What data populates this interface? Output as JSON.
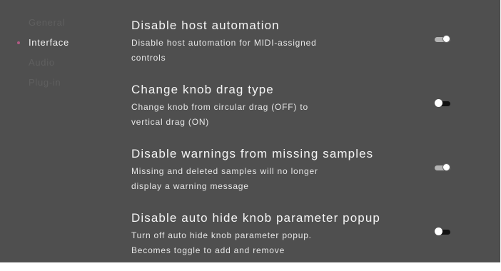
{
  "sidebar": {
    "items": [
      {
        "label": "General"
      },
      {
        "label": "Interface"
      },
      {
        "label": "Audio"
      },
      {
        "label": "Plug-in"
      }
    ],
    "active_index": 1
  },
  "settings": [
    {
      "title": "Disable host automation",
      "desc_line1": "Disable host automation for MIDI-assigned",
      "desc_line2": "controls",
      "toggle_state": "on"
    },
    {
      "title": "Change knob drag type",
      "desc_line1": "Change knob from circular drag (OFF) to",
      "desc_line2": "vertical drag (ON)",
      "toggle_state": "off"
    },
    {
      "title": "Disable warnings from missing samples",
      "desc_line1": "Missing and deleted samples will no longer",
      "desc_line2": "display a warning message",
      "toggle_state": "on"
    },
    {
      "title": "Disable auto hide knob parameter popup",
      "desc_line1": "Turn off auto hide knob parameter popup.",
      "desc_line2": "Becomes toggle to add and remove",
      "toggle_state": "off"
    }
  ],
  "colors": {
    "background": "#4f4f4f",
    "active_indicator": "#b05a83",
    "toggle_on_track": "#b3b3b3",
    "toggle_off_track": "#111111"
  }
}
